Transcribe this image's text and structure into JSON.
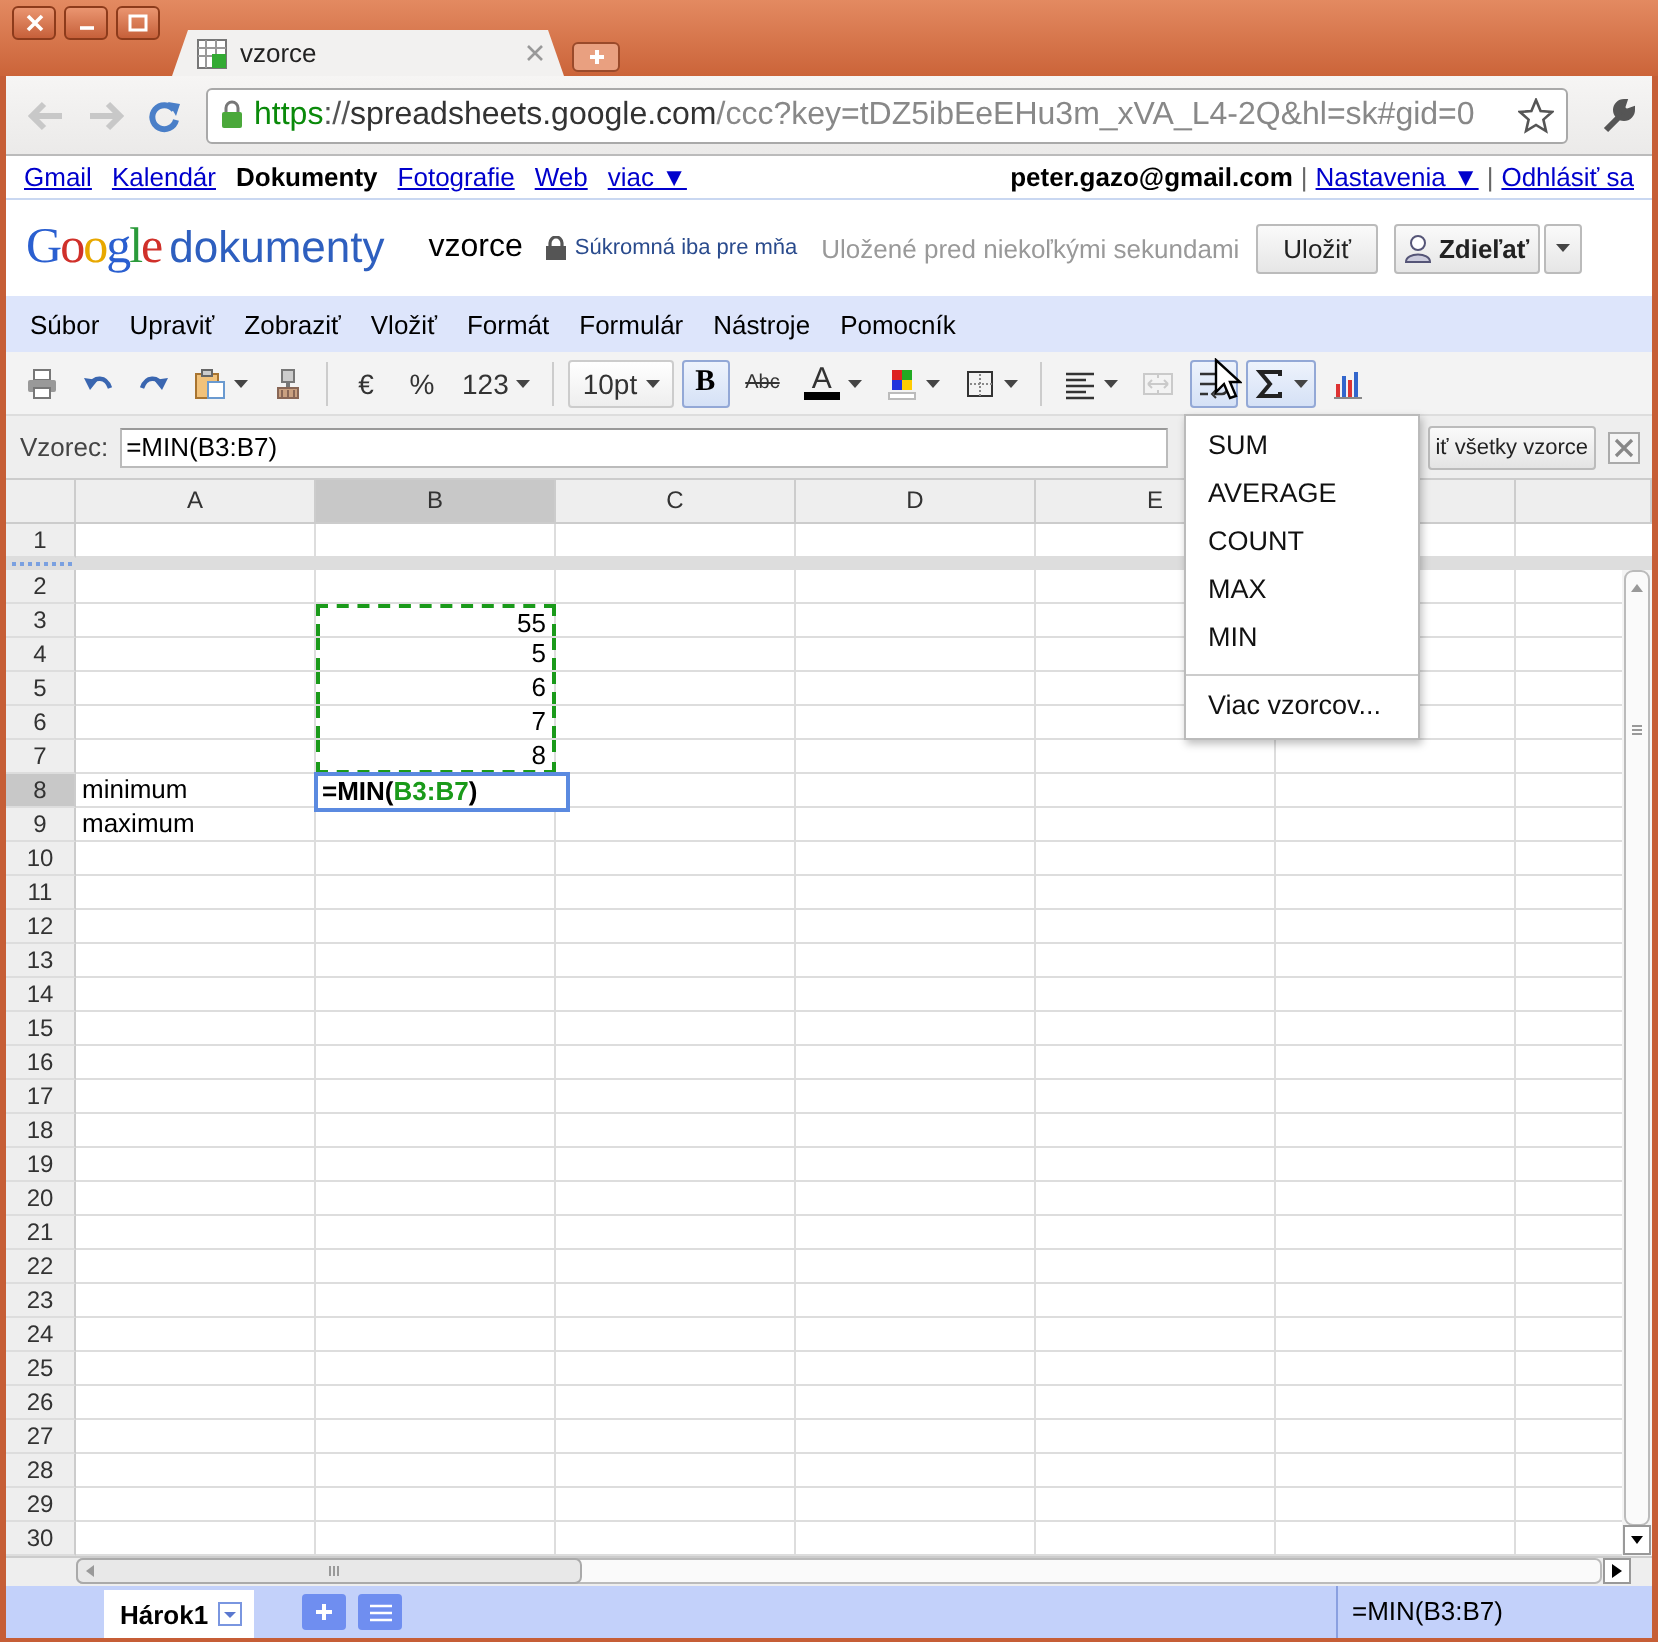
{
  "browser": {
    "tab": {
      "title": "vzorce",
      "selected": true
    },
    "url": {
      "scheme": "https",
      "separator": "://",
      "host": "spreadsheets.google.com",
      "path": "/ccc?key=tDZ5ibEeEHu3m_xVA_L4-2Q&hl=sk#gid=0"
    }
  },
  "gbar": {
    "left": [
      {
        "text": "Gmail",
        "kind": "link"
      },
      {
        "text": "Kalendár",
        "kind": "link"
      },
      {
        "text": "Dokumenty",
        "kind": "current"
      },
      {
        "text": "Fotografie",
        "kind": "link"
      },
      {
        "text": "Web",
        "kind": "link"
      },
      {
        "text": "viac ▼",
        "kind": "link"
      }
    ],
    "right": [
      {
        "text": "peter.gazo@gmail.com",
        "kind": "account"
      },
      {
        "text": "|",
        "kind": "separator"
      },
      {
        "text": "Nastavenia ▼",
        "kind": "link"
      },
      {
        "text": "|",
        "kind": "separator"
      },
      {
        "text": "Odhlásiť sa",
        "kind": "link"
      }
    ]
  },
  "header": {
    "logo": "Google",
    "product": "dokumenty",
    "doc_title": "vzorce",
    "privacy": "Súkromná iba pre mňa",
    "status": "Uložené pred niekoľkými sekundami",
    "save_button": "Uložiť",
    "share_button": "Zdieľať"
  },
  "menu": [
    "Súbor",
    "Upraviť",
    "Zobraziť",
    "Vložiť",
    "Formát",
    "Formulár",
    "Nástroje",
    "Pomocník"
  ],
  "toolbar": {
    "items": [
      {
        "kind": "print",
        "pressed": false,
        "disabled": false
      },
      {
        "kind": "undo",
        "pressed": false,
        "disabled": false
      },
      {
        "kind": "redo",
        "pressed": false,
        "disabled": false
      },
      {
        "kind": "paste",
        "pressed": false,
        "disabled": false
      },
      {
        "kind": "painter",
        "pressed": false,
        "disabled": false
      },
      {
        "kind": "separator"
      },
      {
        "kind": "currency",
        "label": "€",
        "pressed": false,
        "disabled": false
      },
      {
        "kind": "percent",
        "label": "%",
        "pressed": false,
        "disabled": false
      },
      {
        "kind": "number-format",
        "label": "123",
        "pressed": false,
        "disabled": false
      },
      {
        "kind": "separator"
      },
      {
        "kind": "font-size",
        "label": "10pt",
        "pressed": false,
        "disabled": false
      },
      {
        "kind": "bold",
        "label": "B",
        "pressed": true,
        "disabled": false
      },
      {
        "kind": "strike",
        "label": "Abc",
        "pressed": false,
        "disabled": false
      },
      {
        "kind": "font-color",
        "label": "A",
        "pressed": false,
        "disabled": false
      },
      {
        "kind": "fill-color",
        "pressed": false,
        "disabled": false
      },
      {
        "kind": "borders",
        "pressed": false,
        "disabled": false
      },
      {
        "kind": "separator"
      },
      {
        "kind": "align",
        "pressed": false,
        "disabled": false
      },
      {
        "kind": "merge",
        "pressed": false,
        "disabled": true
      },
      {
        "kind": "wrap",
        "pressed": true,
        "disabled": false
      },
      {
        "kind": "sum",
        "pressed": true,
        "disabled": false
      },
      {
        "kind": "chart",
        "pressed": false,
        "disabled": false
      }
    ]
  },
  "formula_bar": {
    "label": "Vzorec:",
    "value": "=MIN(B3:B7)",
    "button": "iť všetky vzorce"
  },
  "function_menu": [
    {
      "kind": "item",
      "text": "SUM"
    },
    {
      "kind": "item",
      "text": "AVERAGE"
    },
    {
      "kind": "item",
      "text": "COUNT"
    },
    {
      "kind": "item",
      "text": "MAX"
    },
    {
      "kind": "item",
      "text": "MIN"
    },
    {
      "kind": "separator"
    },
    {
      "kind": "item",
      "text": "Viac vzorcov..."
    }
  ],
  "grid": {
    "columns": [
      {
        "label": "A",
        "selected": false
      },
      {
        "label": "B",
        "selected": true
      },
      {
        "label": "C",
        "selected": false
      },
      {
        "label": "D",
        "selected": false
      },
      {
        "label": "E",
        "selected": false
      }
    ],
    "rows": [
      {
        "label": "1",
        "selected": false,
        "frozen": true,
        "range": false
      },
      {
        "label": "2",
        "selected": false,
        "frozen": false,
        "range": false
      },
      {
        "label": "3",
        "selected": false,
        "frozen": false,
        "range": true,
        "b": {
          "kind": "number",
          "text": "55"
        }
      },
      {
        "label": "4",
        "selected": false,
        "frozen": false,
        "range": true,
        "b": {
          "kind": "number",
          "text": "5"
        }
      },
      {
        "label": "5",
        "selected": false,
        "frozen": false,
        "range": true,
        "b": {
          "kind": "number",
          "text": "6"
        }
      },
      {
        "label": "6",
        "selected": false,
        "frozen": false,
        "range": true,
        "b": {
          "kind": "number",
          "text": "7"
        }
      },
      {
        "label": "7",
        "selected": false,
        "frozen": false,
        "range": true,
        "b": {
          "kind": "number",
          "text": "8"
        }
      },
      {
        "label": "8",
        "selected": true,
        "frozen": false,
        "range": false,
        "a": {
          "kind": "text",
          "text": "minimum"
        },
        "b": {
          "kind": "editor",
          "parts": [
            {
              "text": "=MIN(",
              "ref": false
            },
            {
              "text": "B3:B7",
              "ref": true
            },
            {
              "text": ")",
              "ref": false
            }
          ]
        }
      },
      {
        "label": "9",
        "selected": false,
        "frozen": false,
        "range": false,
        "a": {
          "kind": "text",
          "text": "maximum"
        }
      },
      {
        "label": "10",
        "selected": false,
        "frozen": false,
        "range": false
      },
      {
        "label": "11",
        "selected": false,
        "frozen": false,
        "range": false
      },
      {
        "label": "12",
        "selected": false,
        "frozen": false,
        "range": false
      },
      {
        "label": "13",
        "selected": false,
        "frozen": false,
        "range": false
      },
      {
        "label": "14",
        "selected": false,
        "frozen": false,
        "range": false
      },
      {
        "label": "15",
        "selected": false,
        "frozen": false,
        "range": false
      },
      {
        "label": "16",
        "selected": false,
        "frozen": false,
        "range": false
      },
      {
        "label": "17",
        "selected": false,
        "frozen": false,
        "range": false
      },
      {
        "label": "18",
        "selected": false,
        "frozen": false,
        "range": false
      },
      {
        "label": "19",
        "selected": false,
        "frozen": false,
        "range": false
      },
      {
        "label": "20",
        "selected": false,
        "frozen": false,
        "range": false
      },
      {
        "label": "21",
        "selected": false,
        "frozen": false,
        "range": false
      },
      {
        "label": "22",
        "selected": false,
        "frozen": false,
        "range": false
      },
      {
        "label": "23",
        "selected": false,
        "frozen": false,
        "range": false
      },
      {
        "label": "24",
        "selected": false,
        "frozen": false,
        "range": false
      },
      {
        "label": "25",
        "selected": false,
        "frozen": false,
        "range": false
      },
      {
        "label": "26",
        "selected": false,
        "frozen": false,
        "range": false
      },
      {
        "label": "27",
        "selected": false,
        "frozen": false,
        "range": false
      },
      {
        "label": "28",
        "selected": false,
        "frozen": false,
        "range": false
      },
      {
        "label": "29",
        "selected": false,
        "frozen": false,
        "range": false
      },
      {
        "label": "30",
        "selected": false,
        "frozen": false,
        "range": false
      }
    ]
  },
  "footer": {
    "sheets": [
      {
        "label": "Hárok1",
        "selected": true
      }
    ],
    "status": "=MIN(B3:B7)"
  }
}
